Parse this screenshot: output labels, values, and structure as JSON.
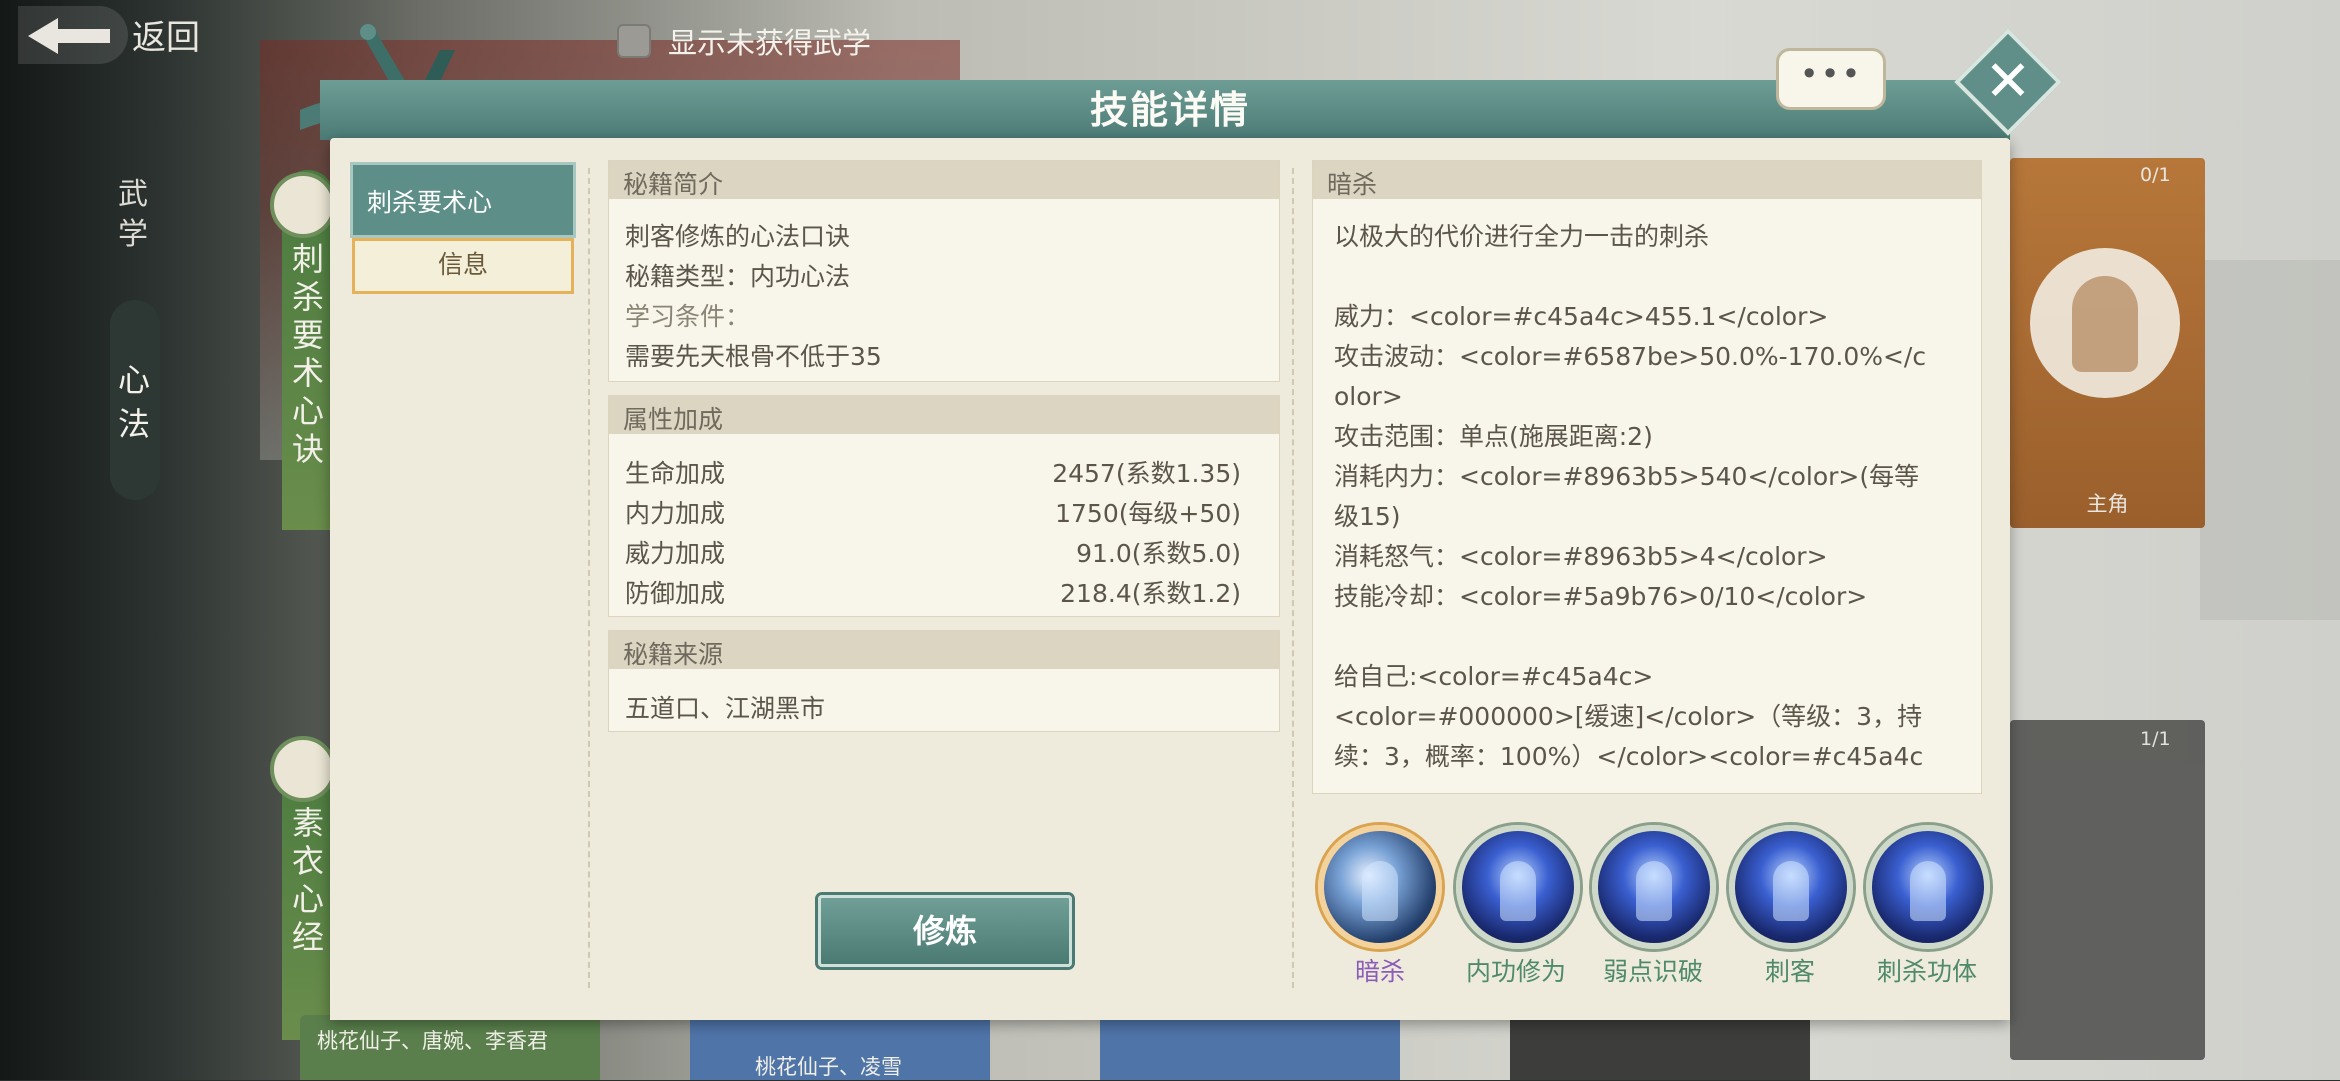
{
  "nav": {
    "back_label": "返回",
    "show_unobtained_label": "显示未获得武学",
    "side_tabs": [
      "武学",
      "心法"
    ]
  },
  "background": {
    "book_columns": [
      "刺杀要术心诀",
      "素衣心经"
    ],
    "right_cards": [
      {
        "count": "0/1",
        "label": "主角"
      },
      {
        "count": "1/1"
      }
    ],
    "bottom_names": [
      "桃花仙子、唐婉、李香君",
      "桃花仙子、凌雪"
    ]
  },
  "dialog": {
    "title": "技能详情",
    "chat_bubble": "•••",
    "close_symbol": "✕",
    "list": {
      "selected_item": "刺杀要术心",
      "info_tab": "信息"
    },
    "intro": {
      "header": "秘籍简介",
      "lines": [
        "刺客修炼的心法口诀",
        "秘籍类型：内功心法",
        "学习条件：",
        "需要先天根骨不低于35"
      ]
    },
    "attributes": {
      "header": "属性加成",
      "rows": [
        {
          "label": "生命加成",
          "value": "2457(系数1.35)"
        },
        {
          "label": "内力加成",
          "value": "1750(每级+50)"
        },
        {
          "label": "威力加成",
          "value": "91.0(系数5.0)"
        },
        {
          "label": "防御加成",
          "value": "218.4(系数1.2)"
        }
      ]
    },
    "source": {
      "header": "秘籍来源",
      "text": "五道口、江湖黑市"
    },
    "practice_button": "修炼",
    "skill_detail": {
      "header": "暗杀",
      "lines": [
        "以极大的代价进行全力一击的刺杀",
        "",
        "威力：<color=#c45a4c>455.1</color>",
        "攻击波动：<color=#6587be>50.0%-170.0%</c",
        "olor>",
        "攻击范围：单点(施展距离:2)",
        "消耗内力：<color=#8963b5>540</color>(每等",
        "级15)",
        "消耗怒气：<color=#8963b5>4</color>",
        "技能冷却：<color=#5a9b76>0/10</color>",
        "",
        "给自己:<color=#c45a4c>",
        "<color=#000000>[缓速]</color>（等级：3，持",
        "续：3，概率：100%）</color><color=#c45a4c"
      ]
    },
    "skills": [
      {
        "label": "暗杀",
        "selected": true,
        "icon": "assassin-skill-icon"
      },
      {
        "label": "内功修为",
        "selected": false,
        "icon": "meditation-skill-icon"
      },
      {
        "label": "弱点识破",
        "selected": false,
        "icon": "meditation-skill-icon"
      },
      {
        "label": "刺客",
        "selected": false,
        "icon": "meditation-skill-icon"
      },
      {
        "label": "刺杀功体",
        "selected": false,
        "icon": "meditation-skill-icon"
      }
    ]
  },
  "colors": {
    "teal": "#5d8e87",
    "panel_bg": "#efebdc",
    "selected_skill_label": "#8b5cb8",
    "skill_label": "#4f8a6a"
  }
}
